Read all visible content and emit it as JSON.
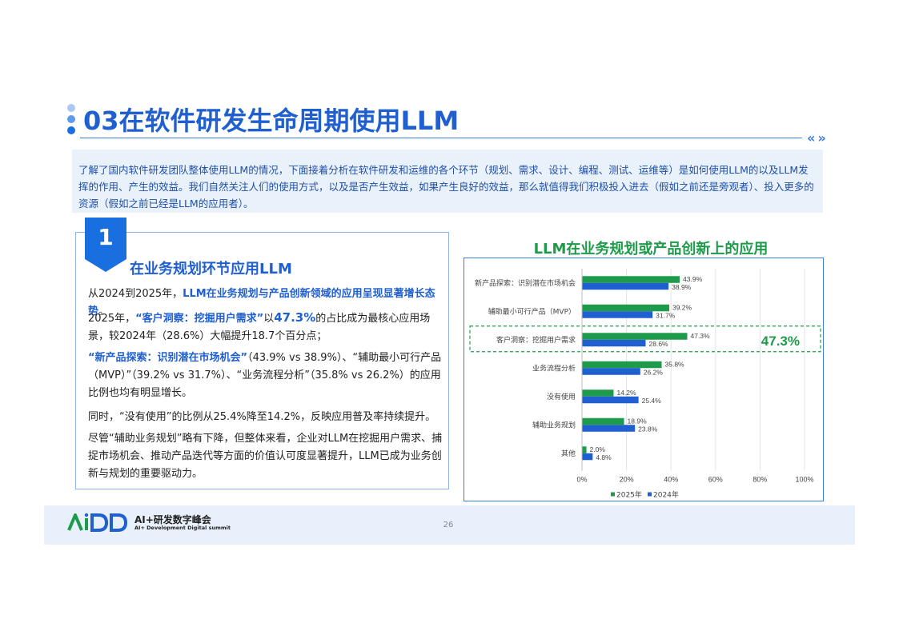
{
  "header": {
    "title": "03在软件研发生命周期使用LLM",
    "intro": "了解了国内软件研发团队整体使用LLM的情况，下面接着分析在软件研发和运维的各个环节（规划、需求、设计、编程、测试、运维等）是如何使用LLM的以及LLM发挥的作用、产生的效益。我们自然关注人们的使用方式，以及是否产生效益，如果产生良好的效益，那么就值得我们积极投入进去（假如之前还是旁观者）、投入更多的资源（假如之前已经是LLM的应用者）。"
  },
  "section": {
    "number": "1",
    "title": "在业务规划环节应用LLM",
    "p1_a": "从2024到2025年，",
    "p1_b": "LLM在业务规划与产品创新领域的应用呈现显著增长态势",
    "p1_c": "。",
    "p2_a": "2025年，",
    "p2_b": "“客户洞察：挖掘用户需求”",
    "p2_c": "以",
    "p2_d": "47.3%",
    "p2_e": "的占比成为最核心应用场景，较2024年（28.6%）大幅提升18.7个百分点；",
    "p3_a": "“新产品探索：识别潜在市场机会”",
    "p3_b": "（43.9% vs 38.9%）、“辅助最小可行产品（MVP）”（39.2% vs 31.7%）、“业务流程分析”（35.8% vs 26.2%）的应用比例也均有明显增长。",
    "p4": "同时，“没有使用”的比例从25.4%降至14.2%，反映应用普及率持续提升。",
    "p5": "尽管“辅助业务规划”略有下降，但整体来看，企业对LLM在挖掘用户需求、捕捉市场机会、推动产品迭代等方面的价值认可度显著提升，LLM已成为业务创新与规划的重要驱动力。"
  },
  "chart_data": {
    "type": "bar",
    "orientation": "horizontal",
    "title": "LLM在业务规划或产品创新上的应用",
    "categories": [
      "新产品探索：识别潜在市场机会",
      "辅助最小可行产品（MVP）",
      "客户洞察：挖掘用户需求",
      "业务流程分析",
      "没有使用",
      "辅助业务规划",
      "其他"
    ],
    "series": [
      {
        "name": "2025年",
        "color": "#1e9b4a",
        "values": [
          43.9,
          39.2,
          47.3,
          35.8,
          14.2,
          18.9,
          2.0
        ]
      },
      {
        "name": "2024年",
        "color": "#1f5fcf",
        "values": [
          38.9,
          31.7,
          28.6,
          26.2,
          25.4,
          23.8,
          4.8
        ]
      }
    ],
    "value_labels_2025": [
      "43.9%",
      "39.2%",
      "47.3%",
      "35.8%",
      "14.2%",
      "18.9%",
      "2.0%"
    ],
    "value_labels_2024": [
      "38.9%",
      "31.7%",
      "28.6%",
      "26.2%",
      "25.4%",
      "23.8%",
      "4.8%"
    ],
    "xlim": [
      0,
      100
    ],
    "xticks": [
      "0%",
      "20%",
      "40%",
      "60%",
      "80%",
      "100%"
    ],
    "highlight_category": "客户洞察：挖掘用户需求",
    "highlight_label": "47.3%",
    "highlight_color": "#1e9b4a",
    "grid": true,
    "legend": "bottom"
  },
  "footer": {
    "logo_text": "AiDD",
    "logo_cn": "AI+研发数字峰会",
    "logo_en": "AI+ Development Digital summit",
    "page": "26"
  }
}
